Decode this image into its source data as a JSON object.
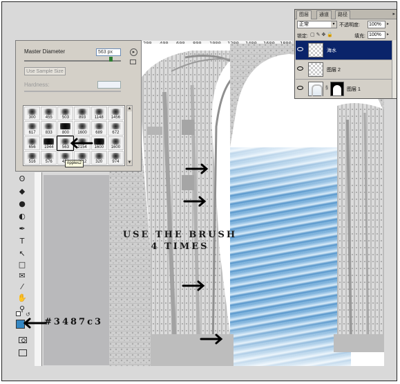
{
  "brush_panel": {
    "master_diameter_label": "Master Diameter",
    "master_diameter_value": "563 px",
    "use_sample_size_label": "Use Sample Size",
    "hardness_label": "Hardness:",
    "presets": [
      {
        "size": "300"
      },
      {
        "size": "455"
      },
      {
        "size": "503"
      },
      {
        "size": "893"
      },
      {
        "size": "1148"
      },
      {
        "size": "1456"
      },
      {
        "size": "617"
      },
      {
        "size": "833"
      },
      {
        "size": "800"
      },
      {
        "size": "1600"
      },
      {
        "size": "689"
      },
      {
        "size": "672"
      },
      {
        "size": "656"
      },
      {
        "size": "1944"
      },
      {
        "size": "563"
      },
      {
        "size": "2154"
      },
      {
        "size": "1600"
      },
      {
        "size": "1600"
      },
      {
        "size": "516"
      },
      {
        "size": "576"
      },
      {
        "size": "421"
      },
      {
        "size": "1112"
      },
      {
        "size": "320"
      },
      {
        "size": "974"
      }
    ],
    "tooltip": "ripples2"
  },
  "ruler": {
    "top_ticks": [
      "200",
      "400",
      "600",
      "800",
      "1000",
      "1200",
      "1400",
      "1600",
      "1800"
    ]
  },
  "layers_panel": {
    "tabs": [
      "图层",
      "通道",
      "路径"
    ],
    "blend_mode": "正常",
    "opacity_label": "不透明度:",
    "opacity_value": "100%",
    "lock_label": "锁定:",
    "fill_label": "填充:",
    "fill_value": "100%",
    "layers": [
      {
        "name": "海水",
        "selected": true
      },
      {
        "name": "图层 2",
        "selected": false
      },
      {
        "name": "图层 1",
        "selected": false
      }
    ]
  },
  "toolbox": {
    "foreground_color": "#3487c3",
    "icons": [
      "lasso-icon",
      "paint-bucket-icon",
      "blur-icon",
      "dodge-icon",
      "pen-icon",
      "type-icon",
      "path-select-icon",
      "shape-icon",
      "notes-icon",
      "eyedropper-icon",
      "hand-icon",
      "zoom-icon"
    ]
  },
  "annotations": {
    "brush_line1": "USE THE BRUSH",
    "brush_line2": "4 TIMES",
    "color_hex": "#3487c3"
  }
}
